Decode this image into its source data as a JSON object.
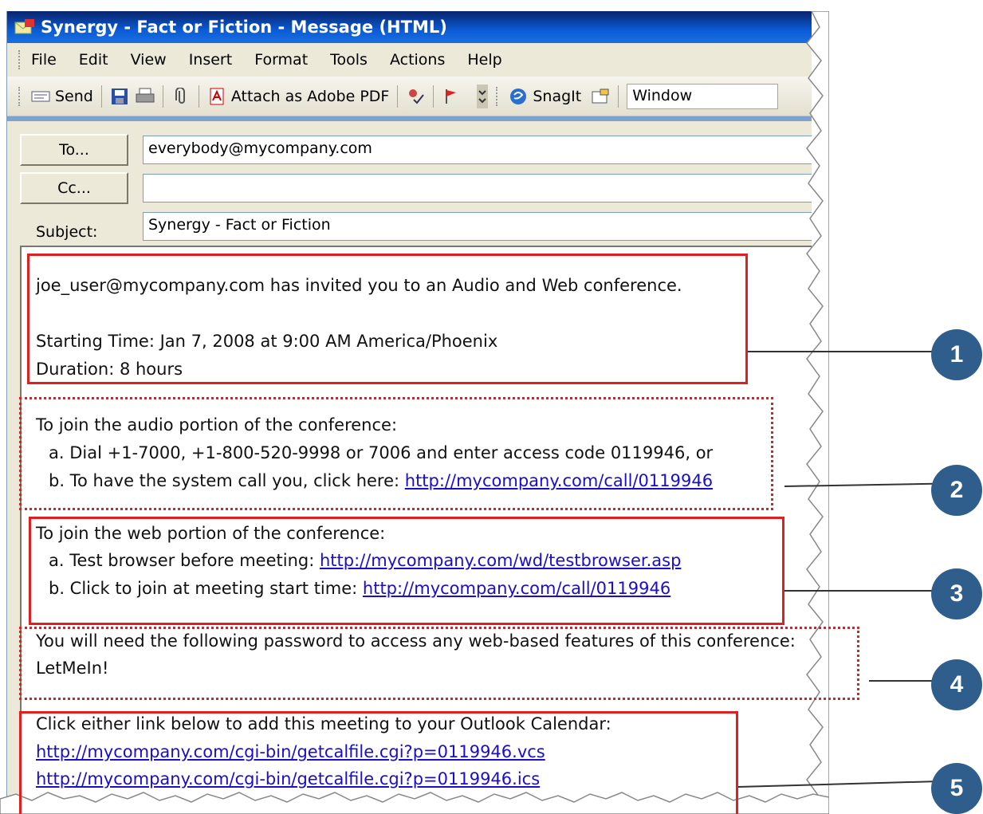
{
  "window": {
    "title": "Synergy - Fact or Fiction - Message (HTML)"
  },
  "menu": [
    "File",
    "Edit",
    "View",
    "Insert",
    "Format",
    "Tools",
    "Actions",
    "Help"
  ],
  "toolbar": {
    "send": "Send",
    "attach_pdf": "Attach as Adobe PDF",
    "snagit": "SnagIt",
    "window_value": "Window"
  },
  "header": {
    "to_button": "To...",
    "to_value": "everybody@mycompany.com",
    "cc_button": "Cc...",
    "cc_value": "",
    "subject_label": "Subject:",
    "subject_value": "Synergy - Fact or Fiction"
  },
  "body": {
    "section1": {
      "invite": "joe_user@mycompany.com has invited you to an Audio and Web conference.",
      "start": "Starting Time:  Jan 7, 2008 at 9:00 AM America/Phoenix",
      "duration": "Duration: 8 hours"
    },
    "section2": {
      "heading": "To join the audio portion of the conference:",
      "a": "a. Dial +1-7000, +1-800-520-9998 or 7006 and enter access code 0119946, or",
      "b_text": "b. To have the system call you, click here: ",
      "b_link": "http://mycompany.com/call/0119946"
    },
    "section3": {
      "heading": "To join the web portion of the conference:",
      "a_text": "a. Test browser before meeting: ",
      "a_link": "http://mycompany.com/wd/testbrowser.asp",
      "b_text": "b. Click to join at meeting start time: ",
      "b_link": "http://mycompany.com/call/0119946"
    },
    "section4": {
      "line1": "You will need the following password to access any web-based features of this conference:",
      "password": "LetMeIn!"
    },
    "section5": {
      "heading": "Click either link below to add this meeting to your Outlook Calendar:",
      "link_vcs": "http://mycompany.com/cgi-bin/getcalfile.cgi?p=0119946.vcs",
      "link_ics": "http://mycompany.com/cgi-bin/getcalfile.cgi?p=0119946.ics"
    }
  },
  "callouts": [
    "1",
    "2",
    "3",
    "4",
    "5"
  ],
  "colors": {
    "highlight_red": "#e02020",
    "callout_blue": "#2f5d8c",
    "link_blue": "#1a0dcc",
    "title_blue": "#0a5bd6"
  }
}
